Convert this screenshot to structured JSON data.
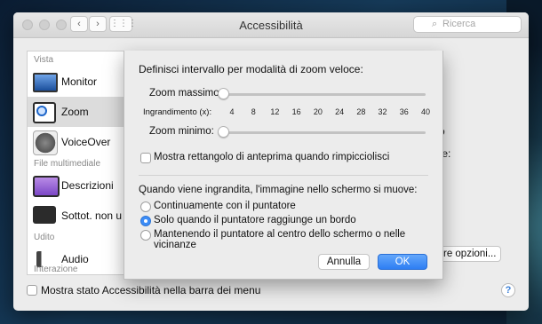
{
  "window": {
    "title": "Accessibilità",
    "search_placeholder": "Ricerca"
  },
  "sidebar": {
    "sections": [
      "Vista",
      "File multimediale",
      "Udito",
      "Interazione"
    ],
    "items": [
      {
        "label": "Monitor",
        "icon": "monitor-icon",
        "selected": false
      },
      {
        "label": "Zoom",
        "icon": "zoom-magnifier-icon",
        "selected": true
      },
      {
        "label": "VoiceOver",
        "icon": "voiceover-icon",
        "selected": false
      },
      {
        "label": "Descrizioni",
        "icon": "descriptions-icon",
        "selected": false
      },
      {
        "label": "Sottot. non u",
        "icon": "captions-icon",
        "selected": false
      },
      {
        "label": "Audio",
        "icon": "speaker-icon",
        "selected": false
      }
    ]
  },
  "right_panel": {
    "partial_text_1": "ato",
    "partial_text_2": "dire:",
    "options_button": "Altre opzioni..."
  },
  "bottom": {
    "checkbox_label": "Mostra stato Accessibilità nella barra dei menu",
    "help": "?"
  },
  "sheet": {
    "title": "Definisci intervallo per modalità di zoom veloce:",
    "zoom_max_label": "Zoom massimo:",
    "scale_label": "Ingrandimento (x):",
    "scale_ticks": [
      "4",
      "8",
      "12",
      "16",
      "20",
      "24",
      "28",
      "32",
      "36",
      "40"
    ],
    "zoom_min_label": "Zoom minimo:",
    "zoom_max_value": 1,
    "zoom_min_value": 1,
    "preview_checkbox_label": "Mostra rettangolo di anteprima quando rimpicciolisci",
    "movement_question": "Quando viene ingrandita, l'immagine nello schermo si muove:",
    "radio_options": [
      {
        "label": "Continuamente con il puntatore",
        "checked": false
      },
      {
        "label": "Solo quando il puntatore raggiunge un bordo",
        "checked": true
      },
      {
        "label": "Mantenendo il puntatore al centro dello schermo o nelle vicinanze",
        "checked": false
      }
    ],
    "cancel_label": "Annulla",
    "ok_label": "OK"
  },
  "colors": {
    "accent": "#3b8cf7",
    "window_bg": "#ececec"
  }
}
